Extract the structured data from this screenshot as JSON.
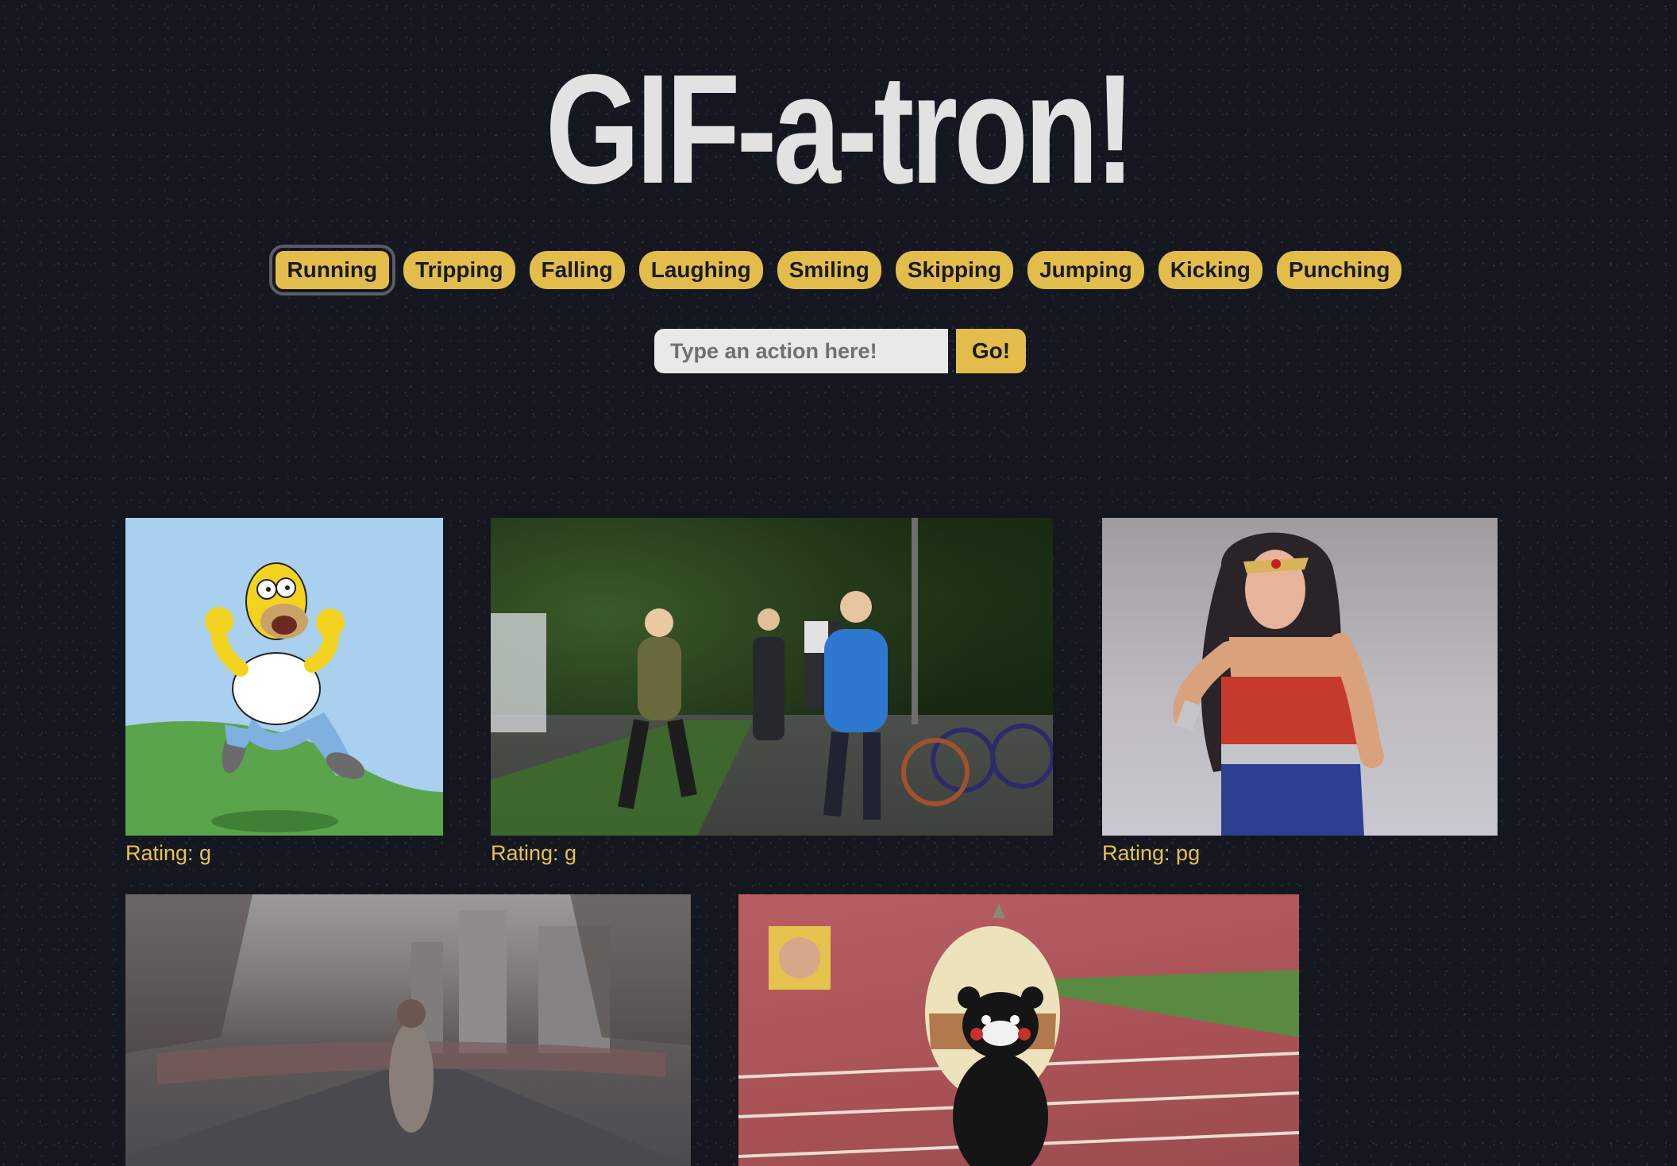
{
  "header": {
    "title": "GIF-a-tron!"
  },
  "actions": [
    {
      "label": "Running",
      "selected": true
    },
    {
      "label": "Tripping",
      "selected": false
    },
    {
      "label": "Falling",
      "selected": false
    },
    {
      "label": "Laughing",
      "selected": false
    },
    {
      "label": "Smiling",
      "selected": false
    },
    {
      "label": "Skipping",
      "selected": false
    },
    {
      "label": "Jumping",
      "selected": false
    },
    {
      "label": "Kicking",
      "selected": false
    },
    {
      "label": "Punching",
      "selected": false
    }
  ],
  "search": {
    "placeholder": "Type an action here!",
    "value": "",
    "button_label": "Go!"
  },
  "gifs": [
    {
      "rating": "Rating: g",
      "subject": "homer-simpson-running"
    },
    {
      "rating": "Rating: g",
      "subject": "park-joggers"
    },
    {
      "rating": "Rating: pg",
      "subject": "wonder-woman-running"
    },
    {
      "rating": "",
      "subject": "street-crowd-running"
    },
    {
      "rating": "",
      "subject": "mascots-track-race"
    }
  ],
  "colors": {
    "background": "#141720",
    "accent": "#e3bd4b",
    "title": "#e2e2e2",
    "rating_text": "#e8c24a"
  }
}
